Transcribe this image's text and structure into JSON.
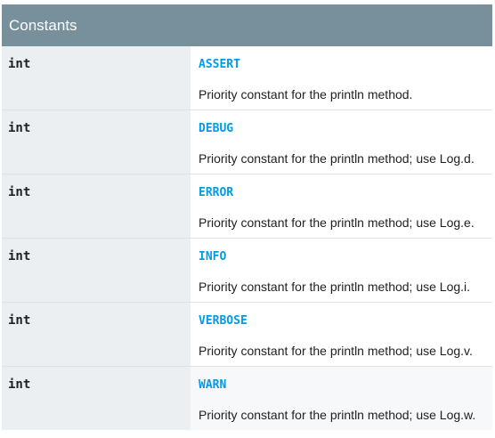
{
  "table": {
    "title": "Constants",
    "rows": [
      {
        "type": "int",
        "name": "ASSERT",
        "description": "Priority constant for the println method."
      },
      {
        "type": "int",
        "name": "DEBUG",
        "description": "Priority constant for the println method; use Log.d."
      },
      {
        "type": "int",
        "name": "ERROR",
        "description": "Priority constant for the println method; use Log.e."
      },
      {
        "type": "int",
        "name": "INFO",
        "description": "Priority constant for the println method; use Log.i."
      },
      {
        "type": "int",
        "name": "VERBOSE",
        "description": "Priority constant for the println method; use Log.v."
      },
      {
        "type": "int",
        "name": "WARN",
        "description": "Priority constant for the println method; use Log.w."
      }
    ]
  }
}
